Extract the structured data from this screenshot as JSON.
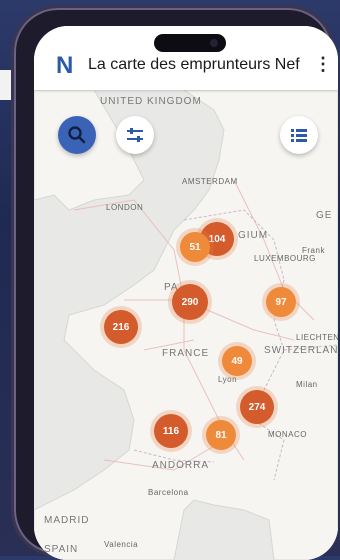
{
  "app": {
    "title": "La carte des emprunteurs Nef",
    "logo": "N"
  },
  "toolbar": {
    "search_icon": "search-icon",
    "filter_icon": "filter-icon",
    "list_icon": "list-icon"
  },
  "map": {
    "places": {
      "united_kingdom": "UNITED KINGDOM",
      "amsterdam": "AMSTERDAM",
      "london": "LONDON",
      "belgium": "GIUM",
      "luxembourg": "LUXEMBOURG",
      "frankfurt": "Frank",
      "ge": "GE",
      "pa": "PA",
      "france": "FRANCE",
      "liechtenstein": "LIECHTEN",
      "switzerland": "SWITZERLAN",
      "lyon": "Lyon",
      "milan": "Milan",
      "monaco": "MONACO",
      "andorra": "ANDORRA",
      "barcelona": "Barcelona",
      "madrid": "MADRID",
      "valencia": "Valencia",
      "spain": "SPAIN"
    },
    "clusters": [
      {
        "id": "104",
        "label": "104",
        "tone": "dark"
      },
      {
        "id": "51",
        "label": "51",
        "tone": "light"
      },
      {
        "id": "290",
        "label": "290",
        "tone": "dark"
      },
      {
        "id": "97",
        "label": "97",
        "tone": "light"
      },
      {
        "id": "216",
        "label": "216",
        "tone": "dark"
      },
      {
        "id": "49",
        "label": "49",
        "tone": "light"
      },
      {
        "id": "274",
        "label": "274",
        "tone": "dark"
      },
      {
        "id": "116",
        "label": "116",
        "tone": "dark"
      },
      {
        "id": "81",
        "label": "81",
        "tone": "light"
      }
    ]
  },
  "colors": {
    "cluster_dark": "#d35b2c",
    "cluster_light": "#ef8a3a",
    "accent": "#3a63b8"
  }
}
